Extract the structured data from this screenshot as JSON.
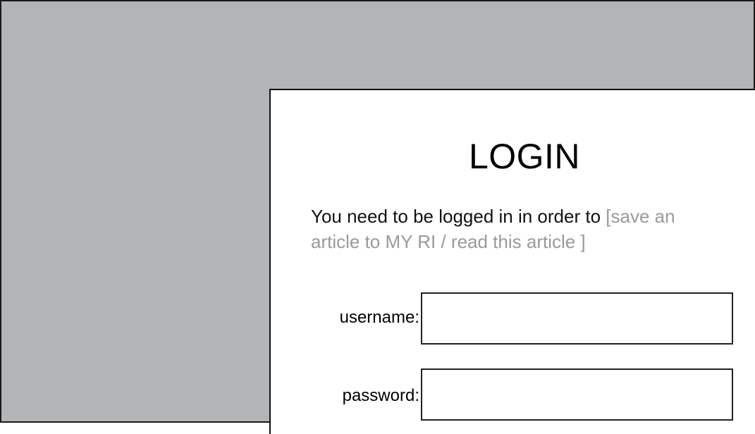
{
  "login": {
    "title": "LOGIN",
    "message_line1": "You need to be logged in in order to ",
    "message_placeholder_line1": "[save an",
    "message_placeholder_line2": "article to MY RI / read this article ]",
    "username_label": "username:",
    "username_value": "",
    "password_label": "password:",
    "password_value": ""
  },
  "colors": {
    "backdrop": "#b3b4b6",
    "panel": "#ffffff",
    "placeholder_text": "#9a9a9a",
    "border": "#111111"
  }
}
